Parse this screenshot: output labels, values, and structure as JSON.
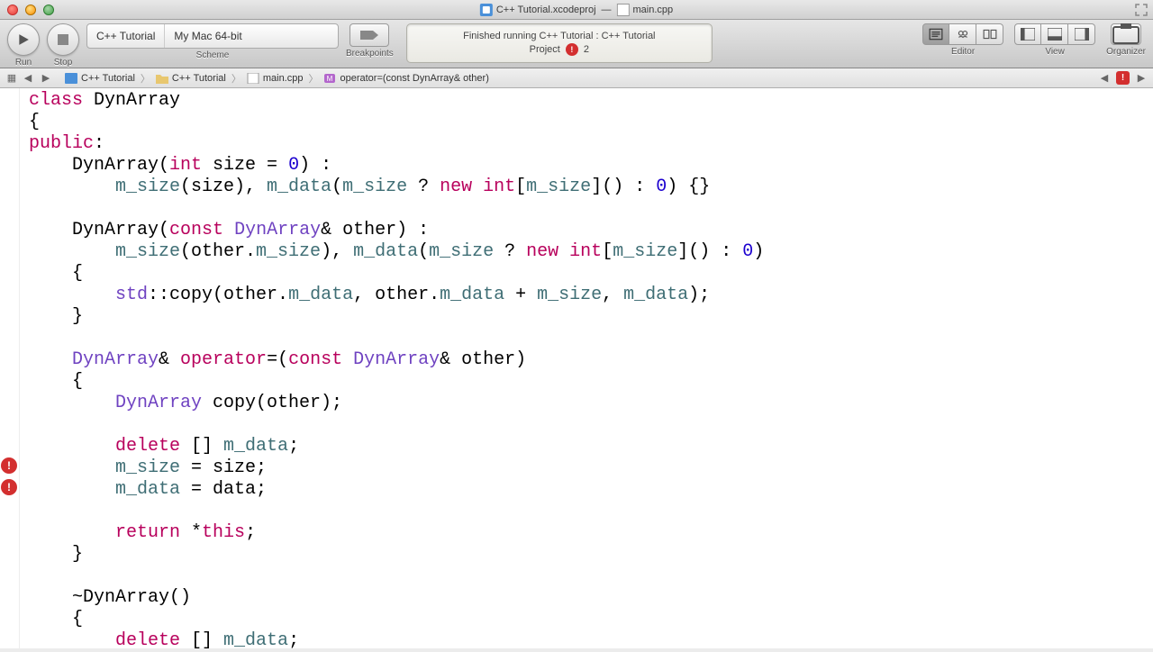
{
  "titlebar": {
    "project": "C++ Tutorial.xcodeproj",
    "separator": "—",
    "file": "main.cpp"
  },
  "toolbar": {
    "run_label": "Run",
    "stop_label": "Stop",
    "scheme_label": "Scheme",
    "scheme_target": "C++ Tutorial",
    "scheme_dest": "My Mac 64-bit",
    "breakpoints_label": "Breakpoints",
    "activity_status": "Finished running C++ Tutorial : C++ Tutorial",
    "activity_project_label": "Project",
    "activity_issue_count": "2",
    "editor_label": "Editor",
    "view_label": "View",
    "organizer_label": "Organizer"
  },
  "jumpbar": {
    "items": [
      "C++ Tutorial",
      "C++ Tutorial",
      "main.cpp",
      "operator=(const DynArray& other)"
    ]
  },
  "code": {
    "l1a": "class",
    "l1b": " DynArray",
    "l2": "{",
    "l3a": "public",
    "l3b": ":",
    "l4a": "    DynArray(",
    "l4b": "int",
    "l4c": " size = ",
    "l4d": "0",
    "l4e": ") :",
    "l5a": "        ",
    "l5b": "m_size",
    "l5c": "(size), ",
    "l5d": "m_data",
    "l5e": "(",
    "l5f": "m_size",
    "l5g": " ? ",
    "l5h": "new",
    "l5i": " ",
    "l5j": "int",
    "l5k": "[",
    "l5l": "m_size",
    "l5m": "]() : ",
    "l5n": "0",
    "l5o": ") {}",
    "l6": "",
    "l7a": "    DynArray(",
    "l7b": "const",
    "l7c": " ",
    "l7d": "DynArray",
    "l7e": "& other) :",
    "l8a": "        ",
    "l8b": "m_size",
    "l8c": "(other.",
    "l8d": "m_size",
    "l8e": "), ",
    "l8f": "m_data",
    "l8g": "(",
    "l8h": "m_size",
    "l8i": " ? ",
    "l8j": "new",
    "l8k": " ",
    "l8l": "int",
    "l8m": "[",
    "l8n": "m_size",
    "l8o": "]() : ",
    "l8p": "0",
    "l8q": ")",
    "l9": "    {",
    "l10a": "        ",
    "l10b": "std",
    "l10c": "::copy(other.",
    "l10d": "m_data",
    "l10e": ", other.",
    "l10f": "m_data",
    "l10g": " + ",
    "l10h": "m_size",
    "l10i": ", ",
    "l10j": "m_data",
    "l10k": ");",
    "l11": "    }",
    "l12": "",
    "l13a": "    ",
    "l13b": "DynArray",
    "l13c": "& ",
    "l13d": "operator",
    "l13e": "=(",
    "l13f": "const",
    "l13g": " ",
    "l13h": "DynArray",
    "l13i": "& other)",
    "l14": "    {",
    "l15a": "        ",
    "l15b": "DynArray",
    "l15c": " copy(other);",
    "l16": "",
    "l17a": "        ",
    "l17b": "delete",
    "l17c": " [] ",
    "l17d": "m_data",
    "l17e": ";",
    "l18a": "        ",
    "l18b": "m_size",
    "l18c": " = size;",
    "l19a": "        ",
    "l19b": "m_data",
    "l19c": " = data;",
    "l20": "",
    "l21a": "        ",
    "l21b": "return",
    "l21c": " *",
    "l21d": "this",
    "l21e": ";",
    "l22": "    }",
    "l23": "",
    "l24": "    ~DynArray()",
    "l25": "    {",
    "l26a": "        ",
    "l26b": "delete",
    "l26c": " [] ",
    "l26d": "m_data",
    "l26e": ";"
  }
}
